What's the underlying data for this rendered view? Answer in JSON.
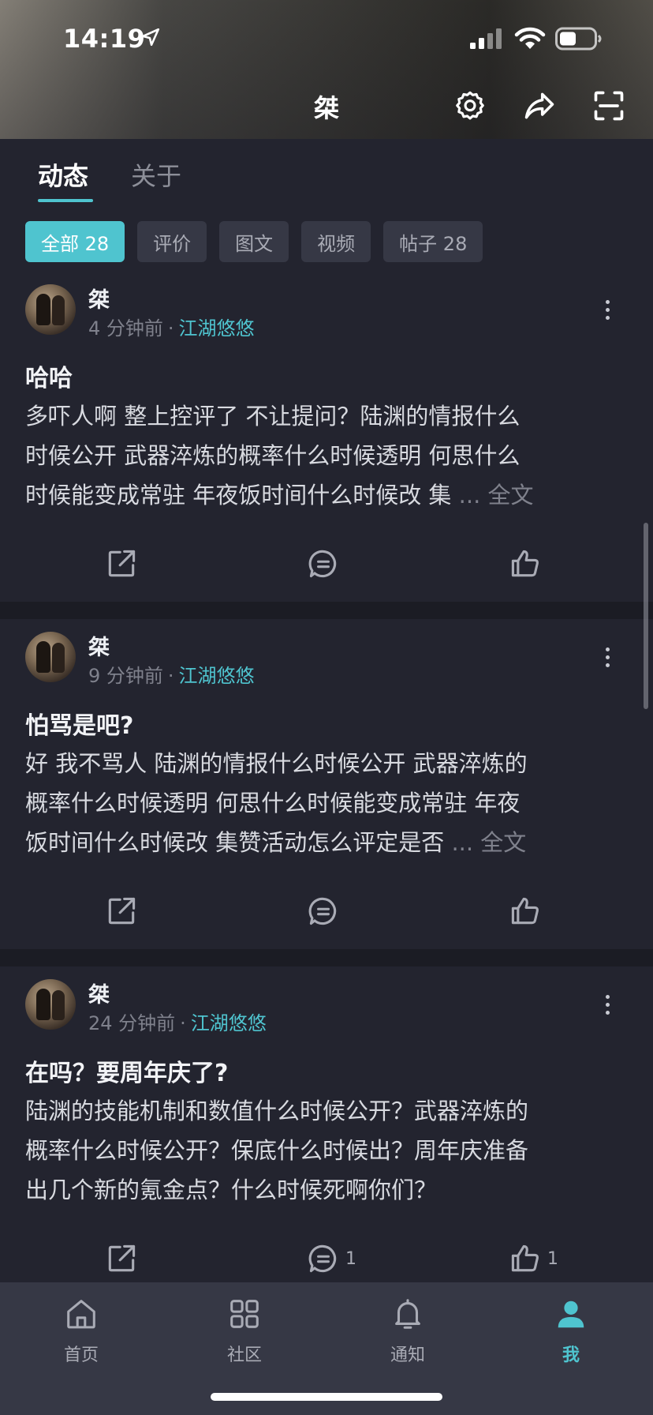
{
  "status_bar": {
    "time": "14:19"
  },
  "nav": {
    "title": "桀"
  },
  "tabs": [
    {
      "label": "动态",
      "active": true
    },
    {
      "label": "关于",
      "active": false
    }
  ],
  "filters": [
    {
      "label": "全部 28",
      "active": true
    },
    {
      "label": "评价",
      "active": false
    },
    {
      "label": "图文",
      "active": false
    },
    {
      "label": "视频",
      "active": false
    },
    {
      "label": "帖子 28",
      "active": false
    }
  ],
  "posts": [
    {
      "author": "桀",
      "time": "4 分钟前",
      "separator": "·",
      "topic": "江湖悠悠",
      "title": "哈哈",
      "body_lines": [
        "多吓人啊 整上控评了 不让提问？陆渊的情报什么",
        "时候公开 武器淬炼的概率什么时候透明 何思什么",
        "时候能变成常驻 年夜饭时间什么时候改 集 "
      ],
      "read_more": "... 全文",
      "comment_count": "",
      "like_count": ""
    },
    {
      "author": "桀",
      "time": "9 分钟前",
      "separator": "·",
      "topic": "江湖悠悠",
      "title": "怕骂是吧?",
      "body_lines": [
        "好 我不骂人 陆渊的情报什么时候公开 武器淬炼的",
        "概率什么时候透明 何思什么时候能变成常驻 年夜",
        "饭时间什么时候改 集赞活动怎么评定是否 "
      ],
      "read_more": "... 全文",
      "comment_count": "",
      "like_count": ""
    },
    {
      "author": "桀",
      "time": "24 分钟前",
      "separator": "·",
      "topic": "江湖悠悠",
      "title": "在吗？要周年庆了?",
      "body_lines": [
        "陆渊的技能机制和数值什么时候公开？武器淬炼的",
        "概率什么时候公开？保底什么时候出？周年庆准备",
        "出几个新的氪金点？什么时候死啊你们？"
      ],
      "read_more": "",
      "comment_count": "1",
      "like_count": "1"
    }
  ],
  "bottom_nav": [
    {
      "label": "首页",
      "icon": "home-icon",
      "active": false
    },
    {
      "label": "社区",
      "icon": "grid-icon",
      "active": false
    },
    {
      "label": "通知",
      "icon": "bell-icon",
      "active": false
    },
    {
      "label": "我",
      "icon": "user-icon",
      "active": true
    }
  ],
  "colors": {
    "accent": "#4fc4cf",
    "background": "#23242f",
    "chip": "#363845",
    "separator": "#1b1c24"
  }
}
